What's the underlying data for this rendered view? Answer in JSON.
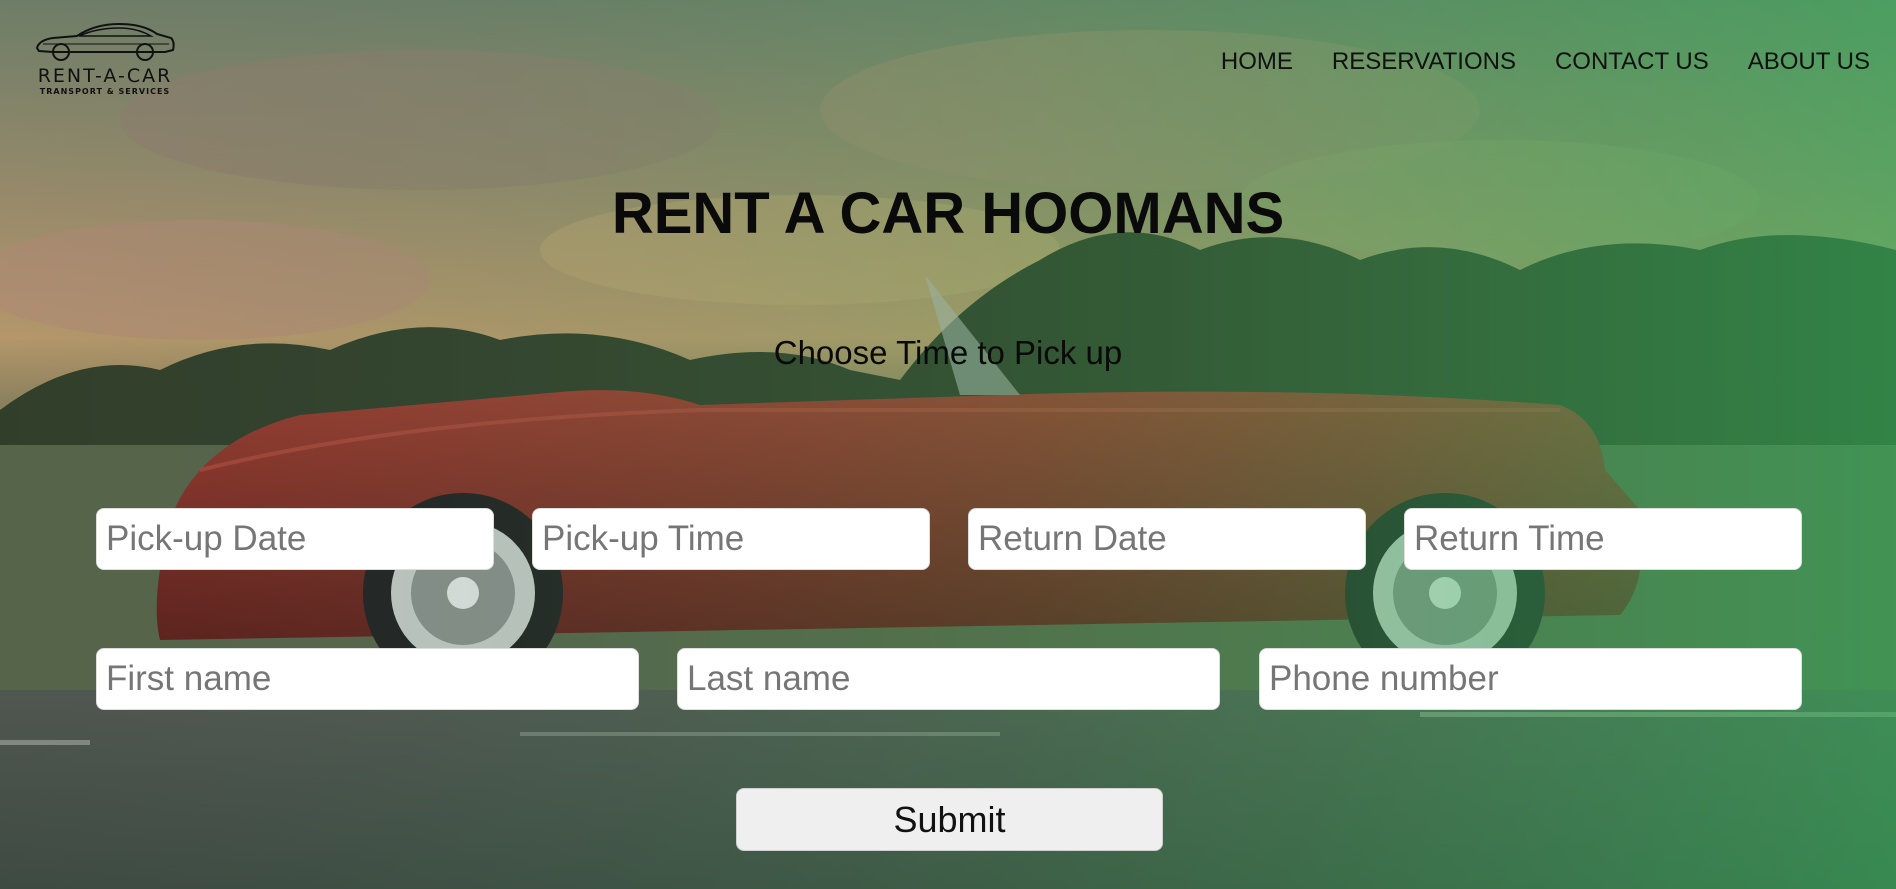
{
  "brand": {
    "name": "RENT-A-CAR",
    "tagline": "TRANSPORT & SERVICES"
  },
  "nav": {
    "items": [
      {
        "label": "HOME"
      },
      {
        "label": "RESERVATIONS"
      },
      {
        "label": "CONTACT US"
      },
      {
        "label": "ABOUT US"
      }
    ]
  },
  "hero": {
    "title": "RENT A CAR HOOMANS",
    "subtitle": "Choose Time to Pick up"
  },
  "form": {
    "pickup_date": {
      "value": "",
      "placeholder": "Pick-up Date"
    },
    "pickup_time": {
      "value": "",
      "placeholder": "Pick-up Time"
    },
    "return_date": {
      "value": "",
      "placeholder": "Return Date"
    },
    "return_time": {
      "value": "",
      "placeholder": "Return Time"
    },
    "first_name": {
      "value": "",
      "placeholder": "First name"
    },
    "last_name": {
      "value": "",
      "placeholder": "Last name"
    },
    "phone": {
      "value": "",
      "placeholder": "Phone number"
    },
    "submit_label": "Submit"
  },
  "icons": {
    "logo": "car-logo-icon",
    "background": "red-convertible-sunset-photo"
  },
  "colors": {
    "overlay_tint": "#3fa35a",
    "car_red": "#8a2a22",
    "input_bg": "#ffffff",
    "button_bg": "#efefef",
    "text": "#111111"
  }
}
